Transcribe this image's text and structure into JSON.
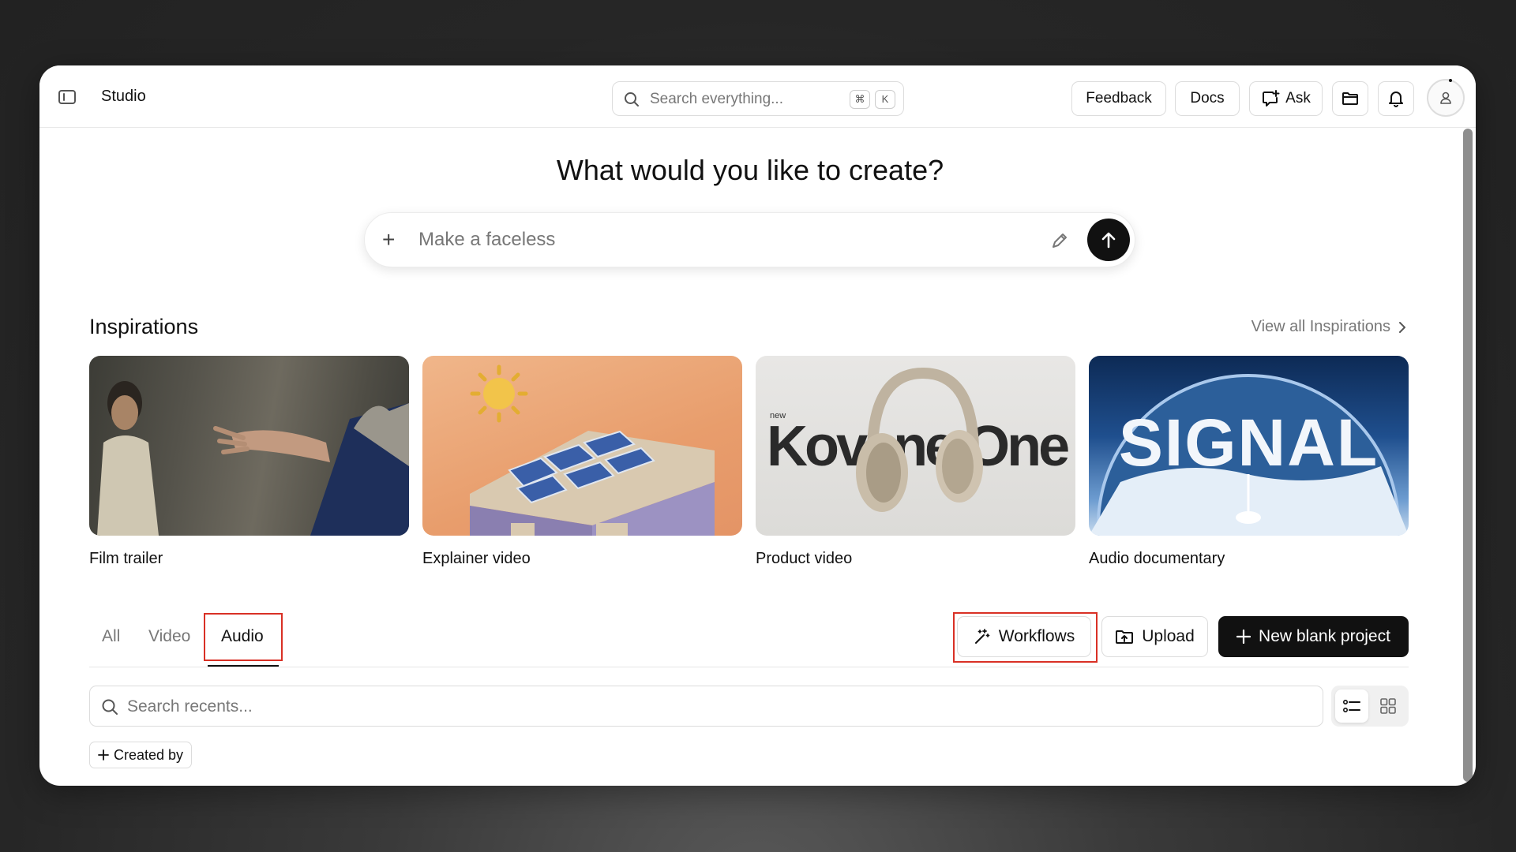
{
  "app": {
    "title": "Studio"
  },
  "search": {
    "placeholder": "Search everything...",
    "shortcut_mod": "⌘",
    "shortcut_key": "K"
  },
  "header_buttons": {
    "feedback": "Feedback",
    "docs": "Docs",
    "ask": "Ask"
  },
  "hero": {
    "headline": "What would you like to create?",
    "prompt_text": "Make a faceless"
  },
  "inspirations": {
    "title": "Inspirations",
    "view_all": "View all Inspirations",
    "cards": [
      {
        "label": "Film trailer"
      },
      {
        "label": "Explainer video"
      },
      {
        "label": "Product video",
        "thumb_small": "new",
        "thumb_text": "Kovane One"
      },
      {
        "label": "Audio documentary",
        "thumb_text": "SIGNAL"
      }
    ]
  },
  "tabs": [
    {
      "label": "All"
    },
    {
      "label": "Video"
    },
    {
      "label": "Audio",
      "active": true
    }
  ],
  "actions": {
    "workflows": "Workflows",
    "upload": "Upload",
    "new_project": "New blank project"
  },
  "recents": {
    "placeholder": "Search recents..."
  },
  "filters": {
    "created_by": "Created by"
  },
  "colors": {
    "highlight": "#d93025",
    "primary": "#111111"
  }
}
